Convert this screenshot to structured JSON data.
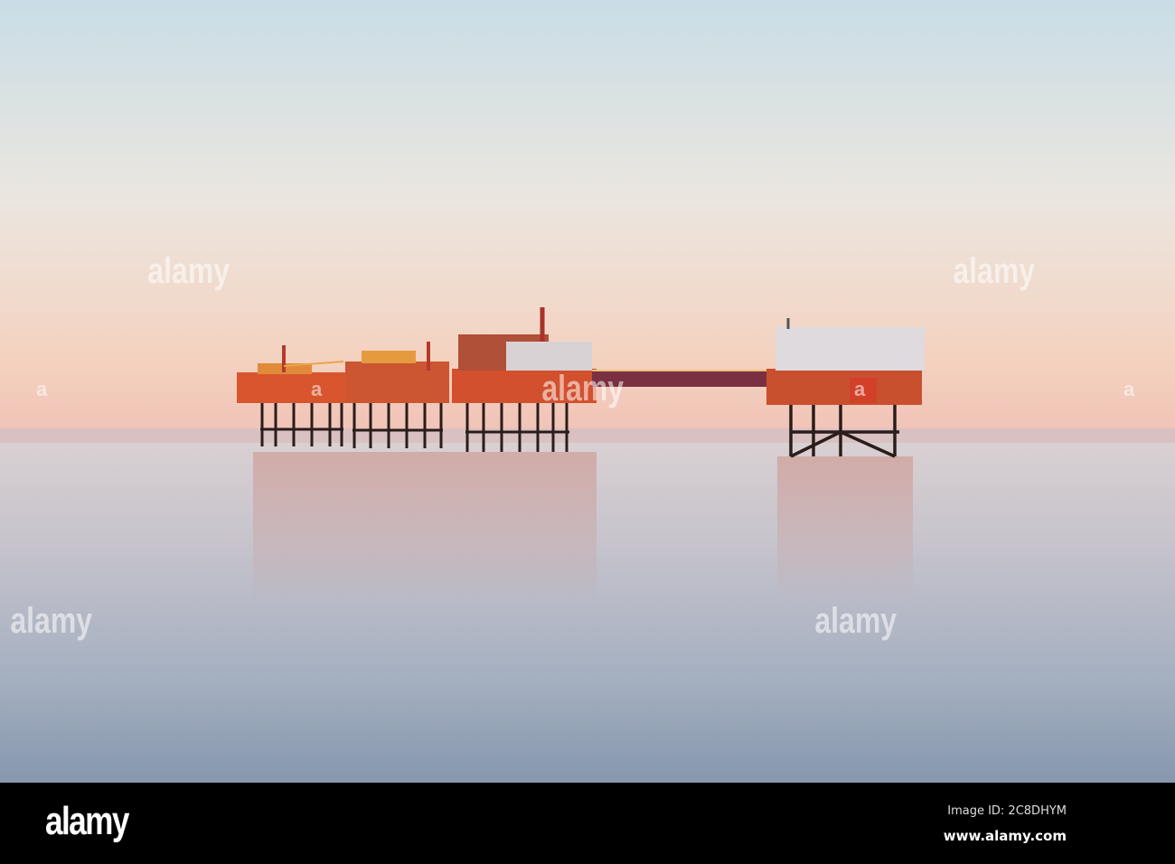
{
  "watermark": {
    "text": "alamy",
    "short": "a"
  },
  "footer": {
    "logo": "alamy",
    "image_id": "Image ID: 2C8DHYM",
    "website": "www.alamy.com"
  }
}
